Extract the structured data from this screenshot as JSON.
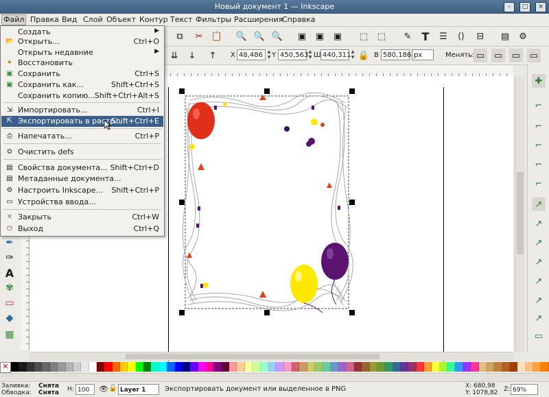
{
  "window": {
    "title": "Новый документ 1 — Inkscape",
    "min_icon": "minimize-icon",
    "max_icon": "maximize-icon",
    "close_icon": "close-icon"
  },
  "menubar": {
    "items": [
      "Файл",
      "Правка",
      "Вид",
      "Слой",
      "Объект",
      "Контур",
      "Текст",
      "Фильтры",
      "Расширения",
      "Справка"
    ]
  },
  "file_menu": {
    "items": [
      {
        "label": "Создать",
        "shortcut": "",
        "icon": "new-icon",
        "submenu": true
      },
      {
        "label": "Открыть...",
        "shortcut": "Ctrl+O",
        "icon": "open-folder-icon"
      },
      {
        "label": "Открыть недавние",
        "shortcut": "",
        "icon": "",
        "submenu": true
      },
      {
        "label": "Восстановить",
        "shortcut": "",
        "icon": "revert-icon"
      },
      {
        "label": "Сохранить",
        "shortcut": "Ctrl+S",
        "icon": "save-icon"
      },
      {
        "label": "Сохранить как...",
        "shortcut": "Shift+Ctrl+S",
        "icon": "save-as-icon"
      },
      {
        "label": "Сохранить копию...",
        "shortcut": "Shift+Ctrl+Alt+S",
        "icon": ""
      },
      {
        "label": "Импортировать...",
        "shortcut": "Ctrl+I",
        "icon": "import-icon"
      },
      {
        "label": "Экспортировать в растр...",
        "shortcut": "Shift+Ctrl+E",
        "icon": "export-bitmap-icon",
        "highlighted": true
      },
      {
        "label": "Напечатать...",
        "shortcut": "Ctrl+P",
        "icon": "print-icon"
      },
      {
        "label": "Очистить defs",
        "shortcut": "",
        "icon": "vacuum-defs-icon"
      },
      {
        "label": "Свойства документа...",
        "shortcut": "Shift+Ctrl+D",
        "icon": "document-properties-icon"
      },
      {
        "label": "Метаданные документа...",
        "shortcut": "",
        "icon": "metadata-icon"
      },
      {
        "label": "Настроить Inkscape...",
        "shortcut": "Shift+Ctrl+P",
        "icon": "preferences-icon"
      },
      {
        "label": "Устройства ввода...",
        "shortcut": "",
        "icon": "input-devices-icon"
      },
      {
        "label": "Закрыть",
        "shortcut": "Ctrl+W",
        "icon": "close-doc-icon"
      },
      {
        "label": "Выход",
        "shortcut": "Ctrl+Q",
        "icon": "quit-icon"
      }
    ]
  },
  "controls": {
    "x_label": "X",
    "x_value": "48,486",
    "y_label": "Y",
    "y_value": "450,563",
    "w_label": "Ш",
    "w_value": "440,311",
    "h_label": "В",
    "h_value": "580,186",
    "unit": "px",
    "scale_label": "Менять:"
  },
  "status": {
    "fill_label": "Заливка:",
    "fill_value": "Снята",
    "stroke_label": "Обводка:",
    "stroke_value": "Снята",
    "opacity_label": "Н:",
    "opacity_value": "100",
    "layer": "Layer 1",
    "message": "Экспортировать документ или выделенное в PNG",
    "coord_x": "X: 680,98",
    "coord_y": "Y: 1078,82",
    "zoom_label": "Z:",
    "zoom_value": "69%"
  },
  "palette": [
    "#000000",
    "#1a1a1a",
    "#333333",
    "#4d4d4d",
    "#666666",
    "#808080",
    "#999999",
    "#b3b3b3",
    "#cccccc",
    "#e6e6e6",
    "#ffffff",
    "#800000",
    "#ff0000",
    "#ff6600",
    "#ffcc00",
    "#ffff00",
    "#00ff00",
    "#008000",
    "#00ffcc",
    "#00ffff",
    "#0066ff",
    "#0000ff",
    "#000080",
    "#6600ff",
    "#ff00ff",
    "#ff0099",
    "#800080",
    "#660033",
    "#ff9999",
    "#ffcc99",
    "#ffff99",
    "#ccff99",
    "#99ffcc",
    "#99ccff",
    "#cc99ff",
    "#ff99cc",
    "#cc6666",
    "#cc9966",
    "#cccc66",
    "#99cc66",
    "#66cc99",
    "#6699cc",
    "#9966cc",
    "#cc6699",
    "#993333",
    "#996633",
    "#999933",
    "#669933",
    "#339966",
    "#336699",
    "#663399",
    "#993366",
    "#ff3333",
    "#ff9933",
    "#ffff33",
    "#99ff33",
    "#33ff99",
    "#3399ff",
    "#9933ff",
    "#ff3399",
    "#e0c080",
    "#d0a060",
    "#c08040",
    "#b06020",
    "#a04000",
    "#ffe0c0",
    "#ffc080",
    "#ffa040",
    "#ff8000"
  ]
}
